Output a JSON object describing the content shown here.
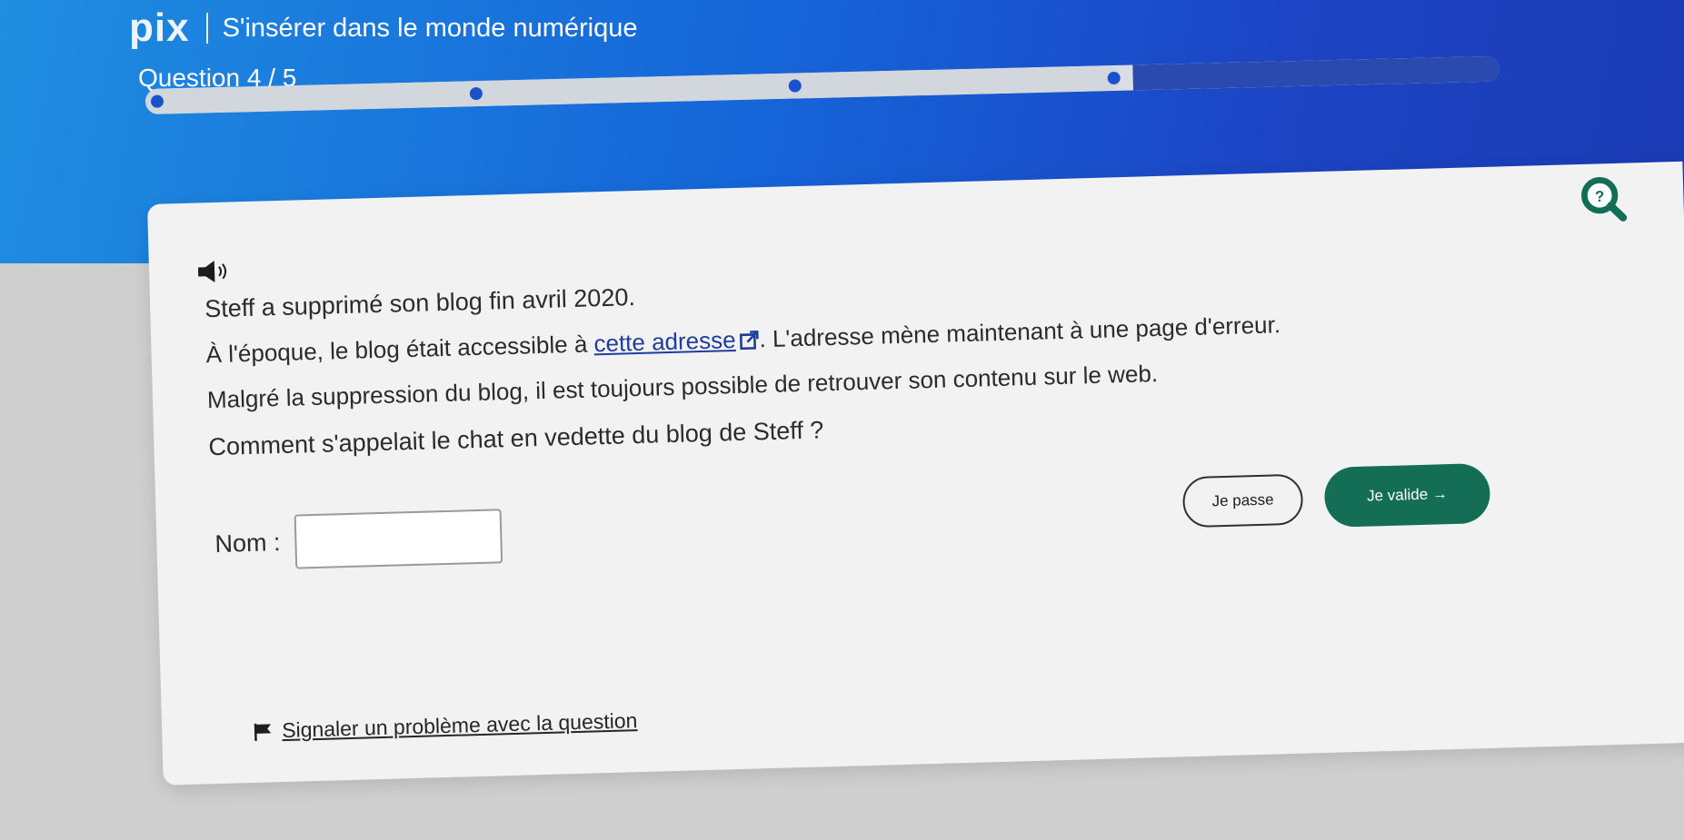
{
  "header": {
    "logo": "pix",
    "course_title": "S'insérer dans le monde numérique",
    "question_counter": "Question 4 / 5",
    "progress": {
      "current": 4,
      "total": 5
    }
  },
  "challenge": {
    "lines": {
      "l1": "Steff a supprimé son blog fin avril 2020.",
      "l2_before": "À l'époque, le blog était accessible à ",
      "l2_link": "cette adresse",
      "l2_after": ". L'adresse mène maintenant à une page d'erreur.",
      "l3": "Malgré la suppression du blog, il est toujours possible de retrouver son contenu sur le web.",
      "l4": "Comment s'appelait le chat en vedette du blog de Steff ?"
    },
    "answer": {
      "label": "Nom :",
      "value": "",
      "placeholder": ""
    },
    "skip_label": "Je passe",
    "validate_label": "Je valide →",
    "report_label": "Signaler un problème avec la question"
  },
  "colors": {
    "header_blue": "#1565d8",
    "validate_green": "#136e55",
    "tutorial_green": "#136e55",
    "link_blue": "#1f3c9e"
  },
  "icons": [
    "tutorial-help-icon",
    "audio-speaker-icon",
    "external-link-icon",
    "flag-icon"
  ]
}
